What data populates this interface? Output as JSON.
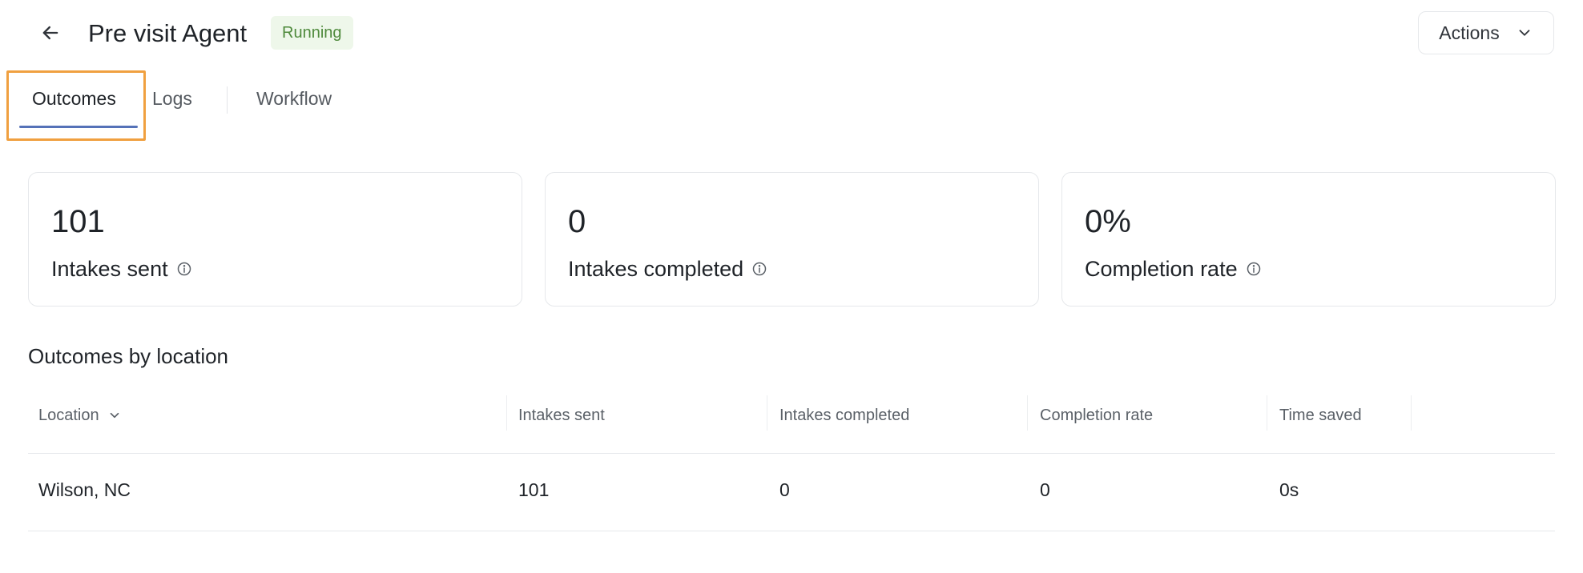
{
  "header": {
    "title": "Pre visit Agent",
    "status": "Running",
    "actions_label": "Actions"
  },
  "tabs": [
    {
      "label": "Outcomes",
      "active": true
    },
    {
      "label": "Logs",
      "active": false
    },
    {
      "label": "Workflow",
      "active": false
    }
  ],
  "stats": [
    {
      "value": "101",
      "label": "Intakes sent"
    },
    {
      "value": "0",
      "label": "Intakes completed"
    },
    {
      "value": "0%",
      "label": "Completion rate"
    }
  ],
  "section": {
    "title": "Outcomes by location"
  },
  "table": {
    "columns": [
      "Location",
      "Intakes sent",
      "Intakes completed",
      "Completion rate",
      "Time saved"
    ],
    "rows": [
      {
        "location": "Wilson, NC",
        "intakes_sent": "101",
        "intakes_completed": "0",
        "completion_rate": "0",
        "time_saved": "0s"
      }
    ]
  },
  "colors": {
    "status_bg": "#eef7ea",
    "status_text": "#4f8a3c",
    "tab_underline": "#5572b8",
    "highlight": "#f0a040"
  },
  "icons": {
    "back": "arrow-left-icon",
    "actions": "chevron-down-icon",
    "info": "info-icon",
    "sort": "chevron-down-icon"
  }
}
